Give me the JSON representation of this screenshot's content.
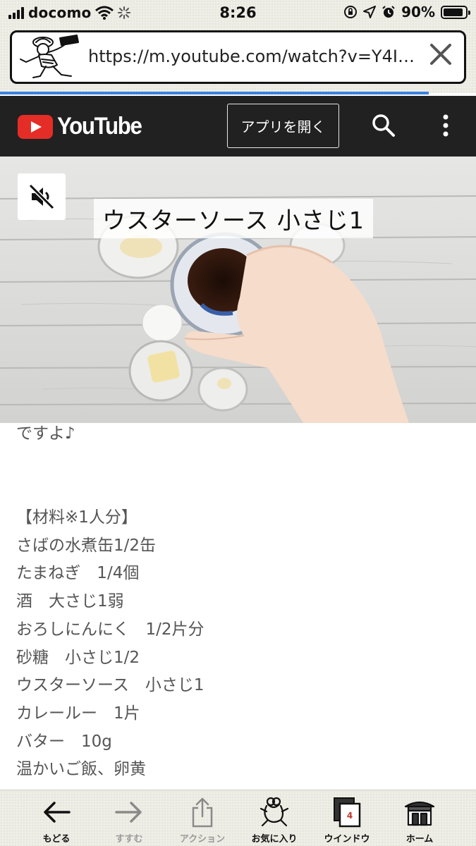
{
  "status_bar": {
    "carrier": "docomo",
    "time": "8:26",
    "battery_percent": "90%",
    "battery_level": 0.9
  },
  "browser": {
    "url": "https://m.youtube.com/watch?v=Y4I…",
    "load_progress": 0.9
  },
  "youtube": {
    "logo_text": "YouTube",
    "open_app_label": "アプリを開く",
    "brand_color": "#e52d27"
  },
  "video": {
    "caption": "ウスターソース  小さじ1"
  },
  "description": {
    "lines": [
      "ですよ♪",
      "",
      "",
      "【材料※1人分】",
      "さばの水煮缶1/2缶",
      "たまねぎ　1/4個",
      "酒　大さじ1弱",
      "おろしにんにく　1/2片分",
      "砂糖　小さじ1/2",
      "ウスターソース　小さじ1",
      "カレールー　1片",
      "バター　10g",
      "温かいご飯、卵黄"
    ]
  },
  "toolbar": {
    "back_label": "もどる",
    "forward_label": "すすむ",
    "action_label": "アクション",
    "favorites_label": "お気に入り",
    "window_label": "ウインドウ",
    "window_count": "4",
    "home_label": "ホーム"
  }
}
